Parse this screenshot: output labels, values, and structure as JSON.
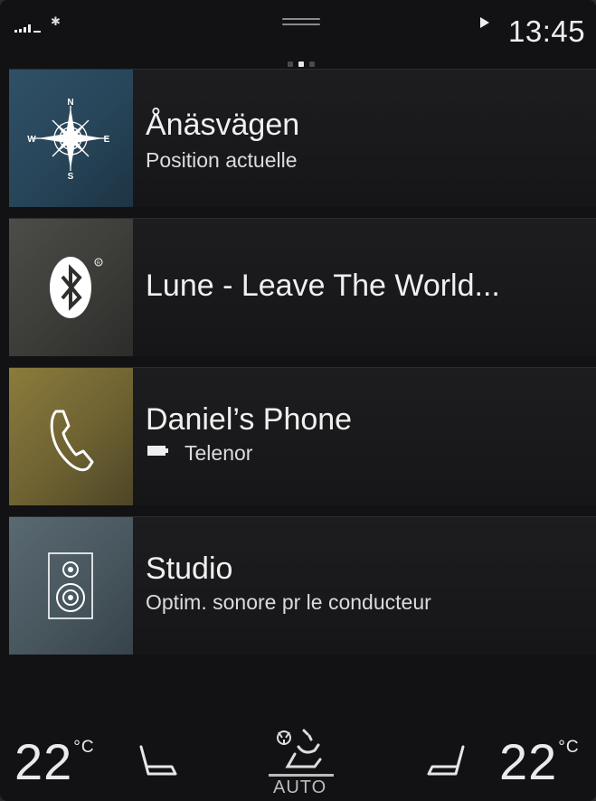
{
  "status_bar": {
    "clock": "13:45",
    "page_indicator": {
      "count": 3,
      "active": 2
    }
  },
  "tiles": [
    {
      "title": "Ånäsvägen",
      "subtitle": "Position actuelle",
      "icon": "compass-icon",
      "compass": {
        "n": "N",
        "s": "S",
        "e": "E",
        "w": "W"
      }
    },
    {
      "title": "Lune - Leave The World...",
      "subtitle": "",
      "icon": "bluetooth-icon"
    },
    {
      "title": "Daniel’s Phone",
      "subtitle": "Telenor",
      "icon": "phone-icon"
    },
    {
      "title": "Studio",
      "subtitle": "Optim. sonore pr le conducteur",
      "icon": "speaker-icon"
    }
  ],
  "climate": {
    "left_temp": "22",
    "right_temp": "22",
    "unit": "°C",
    "auto_label": "AUTO"
  },
  "colors": {
    "background": "#121214",
    "navigation_tile": "#2f5066",
    "media_tile": "#4c4c48",
    "phone_tile": "#8b7b3c",
    "audio_tile": "#5a6a72"
  }
}
